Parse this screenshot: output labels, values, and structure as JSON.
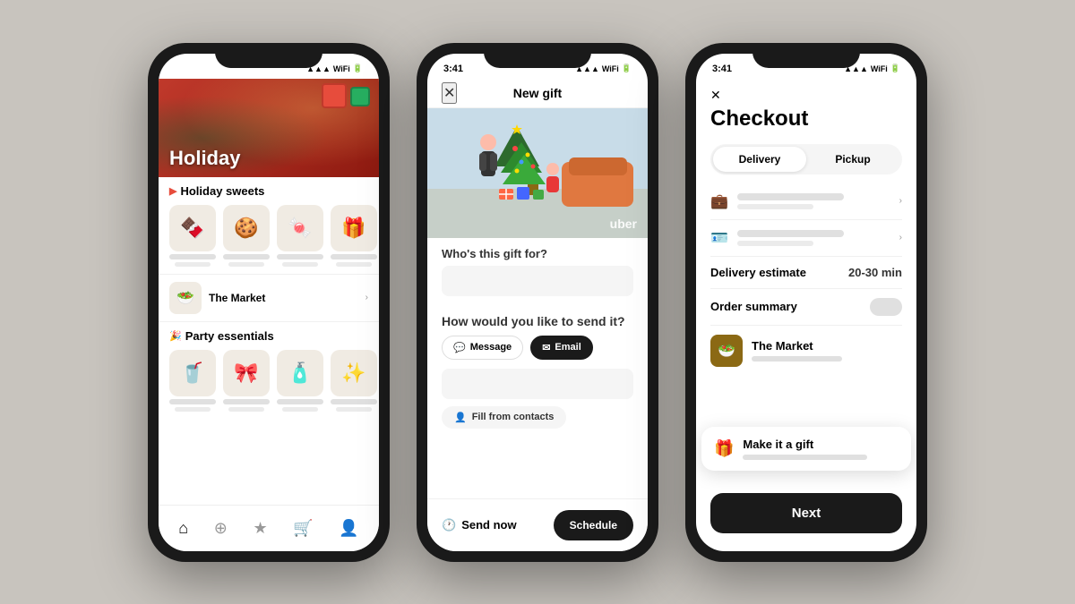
{
  "background": "#c8c4be",
  "phone1": {
    "status_time": "",
    "hero_title": "Holiday",
    "section1_title": "Holiday sweets",
    "section1_fire": "🎄",
    "store_name": "The Market",
    "section2_title": "Party essentials",
    "section2_fire": "🎉",
    "nav_items": [
      "home",
      "search",
      "star",
      "cart",
      "person"
    ]
  },
  "phone2": {
    "status_time": "3:41",
    "title": "New gift",
    "close_icon": "✕",
    "gift_for_label": "Who's this gift for?",
    "gift_input_placeholder": "",
    "send_label": "How would you like to send it?",
    "method_message": "Message",
    "method_email": "Email",
    "fill_contacts": "Fill from contacts",
    "send_now": "Send now",
    "schedule": "Schedule",
    "uber_label": "uber"
  },
  "phone3": {
    "status_time": "3:41",
    "close_icon": "✕",
    "title": "Checkout",
    "tab_delivery": "Delivery",
    "tab_pickup": "Pickup",
    "delivery_estimate_label": "Delivery estimate",
    "delivery_estimate_value": "20-30 min",
    "order_summary_label": "Order summary",
    "market_name": "The Market",
    "make_gift_title": "Make it a gift",
    "next_label": "Next"
  }
}
